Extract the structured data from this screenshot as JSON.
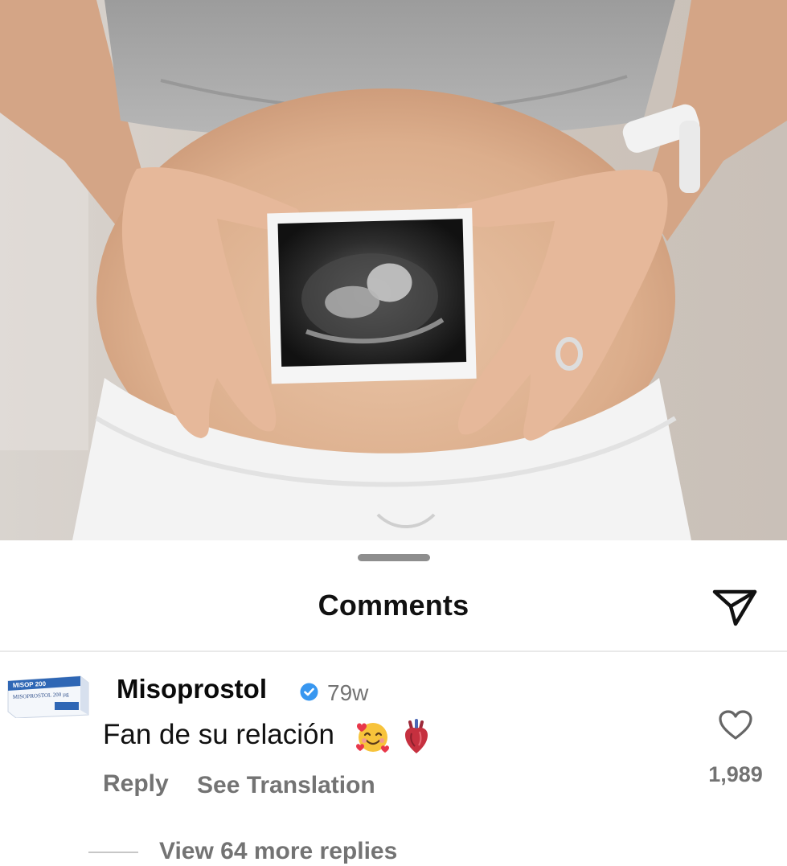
{
  "sheet": {
    "title": "Comments"
  },
  "comment": {
    "username": "Misoprostol",
    "verified": true,
    "time": "79w",
    "text": "Fan de su relación",
    "emojis": [
      "smiling-face-with-hearts-icon",
      "anatomical-heart-icon"
    ],
    "reply_label": "Reply",
    "translate_label": "See Translation",
    "like_count": "1,989",
    "avatar_label_top": "MISOP 200",
    "avatar_label_main": "MISOPROSTOL 200 µg"
  },
  "replies": {
    "label": "View 64 more replies"
  },
  "colors": {
    "verified": "#3897f0",
    "secondary_text": "#737373",
    "primary_text": "#111111"
  }
}
